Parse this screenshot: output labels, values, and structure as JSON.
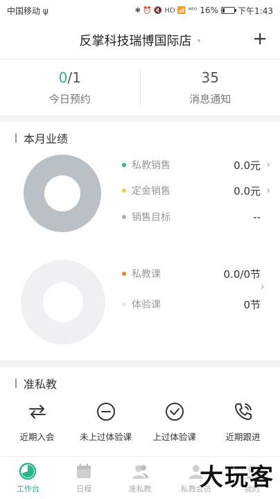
{
  "status_bar": {
    "carrier": "中国移动 ψ",
    "indicators": "✱ ⏰ 🔇 HD 📶 ⁴⁶ᴳ",
    "battery_text": "16%",
    "battery_level": 0.16,
    "time": "下午1:43"
  },
  "header": {
    "store_name": "反掌科技瑞博国际店",
    "caret": "▾",
    "add_label": "+"
  },
  "stats": {
    "appointments": {
      "done": "0",
      "total": "/1",
      "label": "今日预约"
    },
    "messages": {
      "count": "35",
      "label": "消息通知"
    }
  },
  "performance": {
    "title": "本月业绩",
    "colors": {
      "teal": "#2bb58a",
      "yellow": "#f2c94c",
      "gray": "#aaaaaa",
      "orange": "#e8862a",
      "light": "#e6e6e6"
    },
    "sales": [
      {
        "name": "私教销售",
        "value": "0.0元",
        "chevron": "›"
      },
      {
        "name": "定金销售",
        "value": "0.0元",
        "chevron": "›"
      },
      {
        "name": "销售目标",
        "value": "--",
        "chevron": ""
      }
    ],
    "classes": [
      {
        "name": "私教课",
        "value": "0.0/0节"
      },
      {
        "name": "体验课",
        "value": "0节"
      }
    ],
    "classes_chevron": "›"
  },
  "quick_section": {
    "title": "准私教",
    "actions": [
      {
        "label": "近期入会",
        "icon": "swap-arrows-icon"
      },
      {
        "label": "未上过体验课",
        "icon": "minus-circle-icon"
      },
      {
        "label": "上过体验课",
        "icon": "check-circle-icon"
      },
      {
        "label": "近期跟进",
        "icon": "phone-icon"
      }
    ]
  },
  "tabbar": {
    "tabs": [
      {
        "label": "工作台",
        "icon": "dashboard-icon",
        "active": true
      },
      {
        "label": "日程",
        "icon": "calendar-icon"
      },
      {
        "label": "准私教",
        "icon": "users-icon"
      },
      {
        "label": "私教会员",
        "icon": "member-icon"
      },
      {
        "label": "我的",
        "icon": "profile-icon"
      }
    ]
  },
  "watermark": "大玩客"
}
